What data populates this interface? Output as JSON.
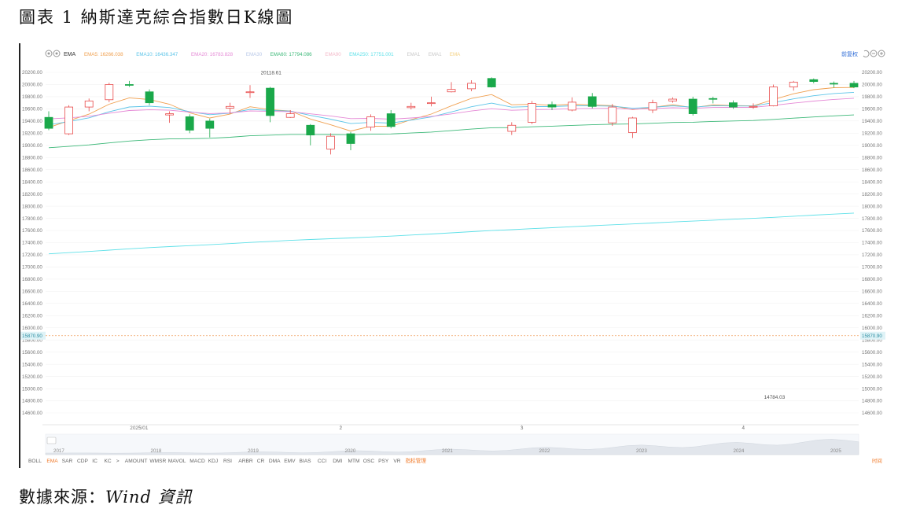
{
  "figure": {
    "title": "圖表 1 納斯達克綜合指數日K線圖",
    "source_label": "數據來源：",
    "source_value": "Wind 資訊"
  },
  "toolbar": {
    "indicator": "EMA",
    "ema_labels": [
      {
        "text": "EMA5: 16266.038",
        "color": "#f0a050"
      },
      {
        "text": "EMA10: 16436.347",
        "color": "#5bc4e8"
      },
      {
        "text": "EMA20: 16783.828",
        "color": "#e58ad6"
      },
      {
        "text": "EMA30",
        "color": "#b8c8e8"
      },
      {
        "text": "EMA60: 17794.086",
        "color": "#3cb878"
      },
      {
        "text": "EMA90",
        "color": "#f4b8c8"
      },
      {
        "text": "EMA250: 17751.001",
        "color": "#5ee0e8"
      },
      {
        "text": "EMA1",
        "color": "#c8c8c8"
      },
      {
        "text": "EMA1",
        "color": "#c8c8c8"
      },
      {
        "text": "EMA",
        "color": "#f4d080"
      }
    ],
    "adjust_label": "前复权"
  },
  "indicators_bar": [
    "BOLL",
    "EMA",
    "SAR",
    "CDP",
    "IC",
    "KC",
    ">",
    "AMOUNT",
    "WMSR",
    "MAVOL",
    "MACD",
    "KDJ",
    "RSI",
    "ARBR",
    "CR",
    "DMA",
    "EMV",
    "BIAS",
    "CCI",
    "DMI",
    "MTM",
    "OSC",
    "PSY",
    "VR",
    "指标管理"
  ],
  "indicators_right": "时间",
  "navigator_years": [
    "2017",
    "2018",
    "2019",
    "2020",
    "2021",
    "2022",
    "2023",
    "2024",
    "2025"
  ],
  "chart_data": {
    "type": "candlestick",
    "ylim": [
      14400,
      20300
    ],
    "y_ticks": [
      "20200.00",
      "20000.00",
      "19800.00",
      "19600.00",
      "19400.00",
      "19200.00",
      "19000.00",
      "18800.00",
      "18600.00",
      "18400.00",
      "18200.00",
      "18000.00",
      "17800.00",
      "17600.00",
      "17400.00",
      "17200.00",
      "17000.00",
      "16800.00",
      "16600.00",
      "16400.00",
      "16200.00",
      "16000.00",
      "15800.00",
      "15600.00",
      "15400.00",
      "15200.00",
      "15000.00",
      "14800.00",
      "14600.00"
    ],
    "x_ticks": [
      {
        "label": "2025/01",
        "index": 4.5
      },
      {
        "label": "2",
        "index": 14.5
      },
      {
        "label": "3",
        "index": 23.5
      },
      {
        "label": "4",
        "index": 34.5
      }
    ],
    "annotations": [
      {
        "text": "20118.61",
        "index": 11,
        "value": 20118.61
      },
      {
        "text": "14784.03",
        "index": 36,
        "value": 14784.03
      }
    ],
    "last_price": "15870.90",
    "candles": [
      {
        "o": 19460,
        "c": 19280,
        "h": 19560,
        "l": 19250
      },
      {
        "o": 19190,
        "c": 19630,
        "h": 19660,
        "l": 19170
      },
      {
        "o": 19630,
        "c": 19730,
        "h": 19770,
        "l": 19560
      },
      {
        "o": 19750,
        "c": 20000,
        "h": 20030,
        "l": 19710
      },
      {
        "o": 20000,
        "c": 19990,
        "h": 20060,
        "l": 19960
      },
      {
        "o": 19880,
        "c": 19700,
        "h": 19920,
        "l": 19660
      },
      {
        "o": 19500,
        "c": 19520,
        "h": 19560,
        "l": 19370
      },
      {
        "o": 19470,
        "c": 19250,
        "h": 19510,
        "l": 19200
      },
      {
        "o": 19400,
        "c": 19280,
        "h": 19440,
        "l": 19130
      },
      {
        "o": 19610,
        "c": 19640,
        "h": 19700,
        "l": 19520
      },
      {
        "o": 19880,
        "c": 19880,
        "h": 19990,
        "l": 19780
      },
      {
        "o": 19940,
        "c": 19490,
        "h": 19960,
        "l": 19380
      },
      {
        "o": 19460,
        "c": 19520,
        "h": 19580,
        "l": 19450
      },
      {
        "o": 19330,
        "c": 19170,
        "h": 19350,
        "l": 19000
      },
      {
        "o": 18940,
        "c": 19150,
        "h": 19200,
        "l": 18850
      },
      {
        "o": 19190,
        "c": 19030,
        "h": 19220,
        "l": 18920
      },
      {
        "o": 19300,
        "c": 19470,
        "h": 19510,
        "l": 19240
      },
      {
        "o": 19520,
        "c": 19310,
        "h": 19580,
        "l": 19280
      },
      {
        "o": 19620,
        "c": 19640,
        "h": 19700,
        "l": 19590
      },
      {
        "o": 19700,
        "c": 19700,
        "h": 19800,
        "l": 19640
      },
      {
        "o": 19880,
        "c": 19920,
        "h": 20040,
        "l": 19870
      },
      {
        "o": 19930,
        "c": 20020,
        "h": 20070,
        "l": 19890
      },
      {
        "o": 20100,
        "c": 19960,
        "h": 20118.61,
        "l": 19950
      },
      {
        "o": 19230,
        "c": 19330,
        "h": 19380,
        "l": 19170
      },
      {
        "o": 19380,
        "c": 19690,
        "h": 19730,
        "l": 19350
      },
      {
        "o": 19670,
        "c": 19630,
        "h": 19720,
        "l": 19580
      },
      {
        "o": 19580,
        "c": 19710,
        "h": 19790,
        "l": 19560
      },
      {
        "o": 19800,
        "c": 19640,
        "h": 19860,
        "l": 19610
      },
      {
        "o": 19370,
        "c": 19630,
        "h": 19680,
        "l": 19320
      },
      {
        "o": 19210,
        "c": 19450,
        "h": 19470,
        "l": 19120
      },
      {
        "o": 19580,
        "c": 19700,
        "h": 19750,
        "l": 19530
      },
      {
        "o": 19730,
        "c": 19760,
        "h": 19790,
        "l": 19700
      },
      {
        "o": 19760,
        "c": 19520,
        "h": 19800,
        "l": 19490
      },
      {
        "o": 19770,
        "c": 19760,
        "h": 19800,
        "l": 19690
      },
      {
        "o": 19700,
        "c": 19630,
        "h": 19740,
        "l": 19600
      },
      {
        "o": 19640,
        "c": 19640,
        "h": 19690,
        "l": 19600
      },
      {
        "o": 19650,
        "c": 19960,
        "h": 20000,
        "l": 19640
      },
      {
        "o": 19960,
        "c": 20040,
        "h": 20060,
        "l": 19900
      },
      {
        "o": 20080,
        "c": 20050,
        "h": 20100,
        "l": 20020
      },
      {
        "o": 20020,
        "c": 20010,
        "h": 20050,
        "l": 19950
      },
      {
        "o": 20020,
        "c": 19960,
        "h": 20060,
        "l": 19940
      }
    ]
  }
}
